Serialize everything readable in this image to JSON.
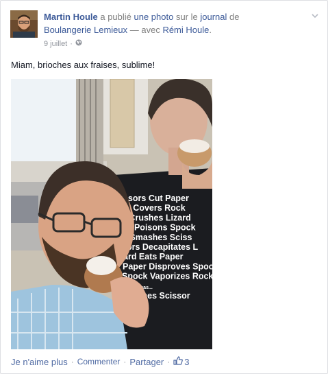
{
  "post": {
    "author": "Martin Houle",
    "verb_1": " a publié ",
    "photo_link": "une photo",
    "verb_2": " sur le ",
    "journal_link": "journal",
    "verb_3": " de ",
    "page_link": "Boulangerie Lemieux",
    "with_text": " — avec ",
    "tagged": "Rémi Houle",
    "period": ".",
    "date": "9 juillet",
    "meta_sep": "·",
    "message": "Miam, brioches aux fraises, sublime!"
  },
  "photo": {
    "shirt_lines": [
      "ssors Cut Paper",
      "er Covers Rock",
      "k Crushes Lizard",
      "rd Poisons Spock",
      "k Smashes Sciss",
      "sors Decapitates L",
      "ard Eats Paper",
      "Paper Disproves Spock",
      "Spock Vaporizes Rock",
      "always has...",
      "Crushes Scissor"
    ]
  },
  "actions": {
    "unlike": "Je n'aime plus",
    "sep": "·",
    "comment": "Commenter",
    "share": "Partager",
    "like_count": "3"
  },
  "icons": {
    "audience": "globe-icon",
    "menu": "chevron-down-icon",
    "likes": "thumbs-up-icon"
  }
}
